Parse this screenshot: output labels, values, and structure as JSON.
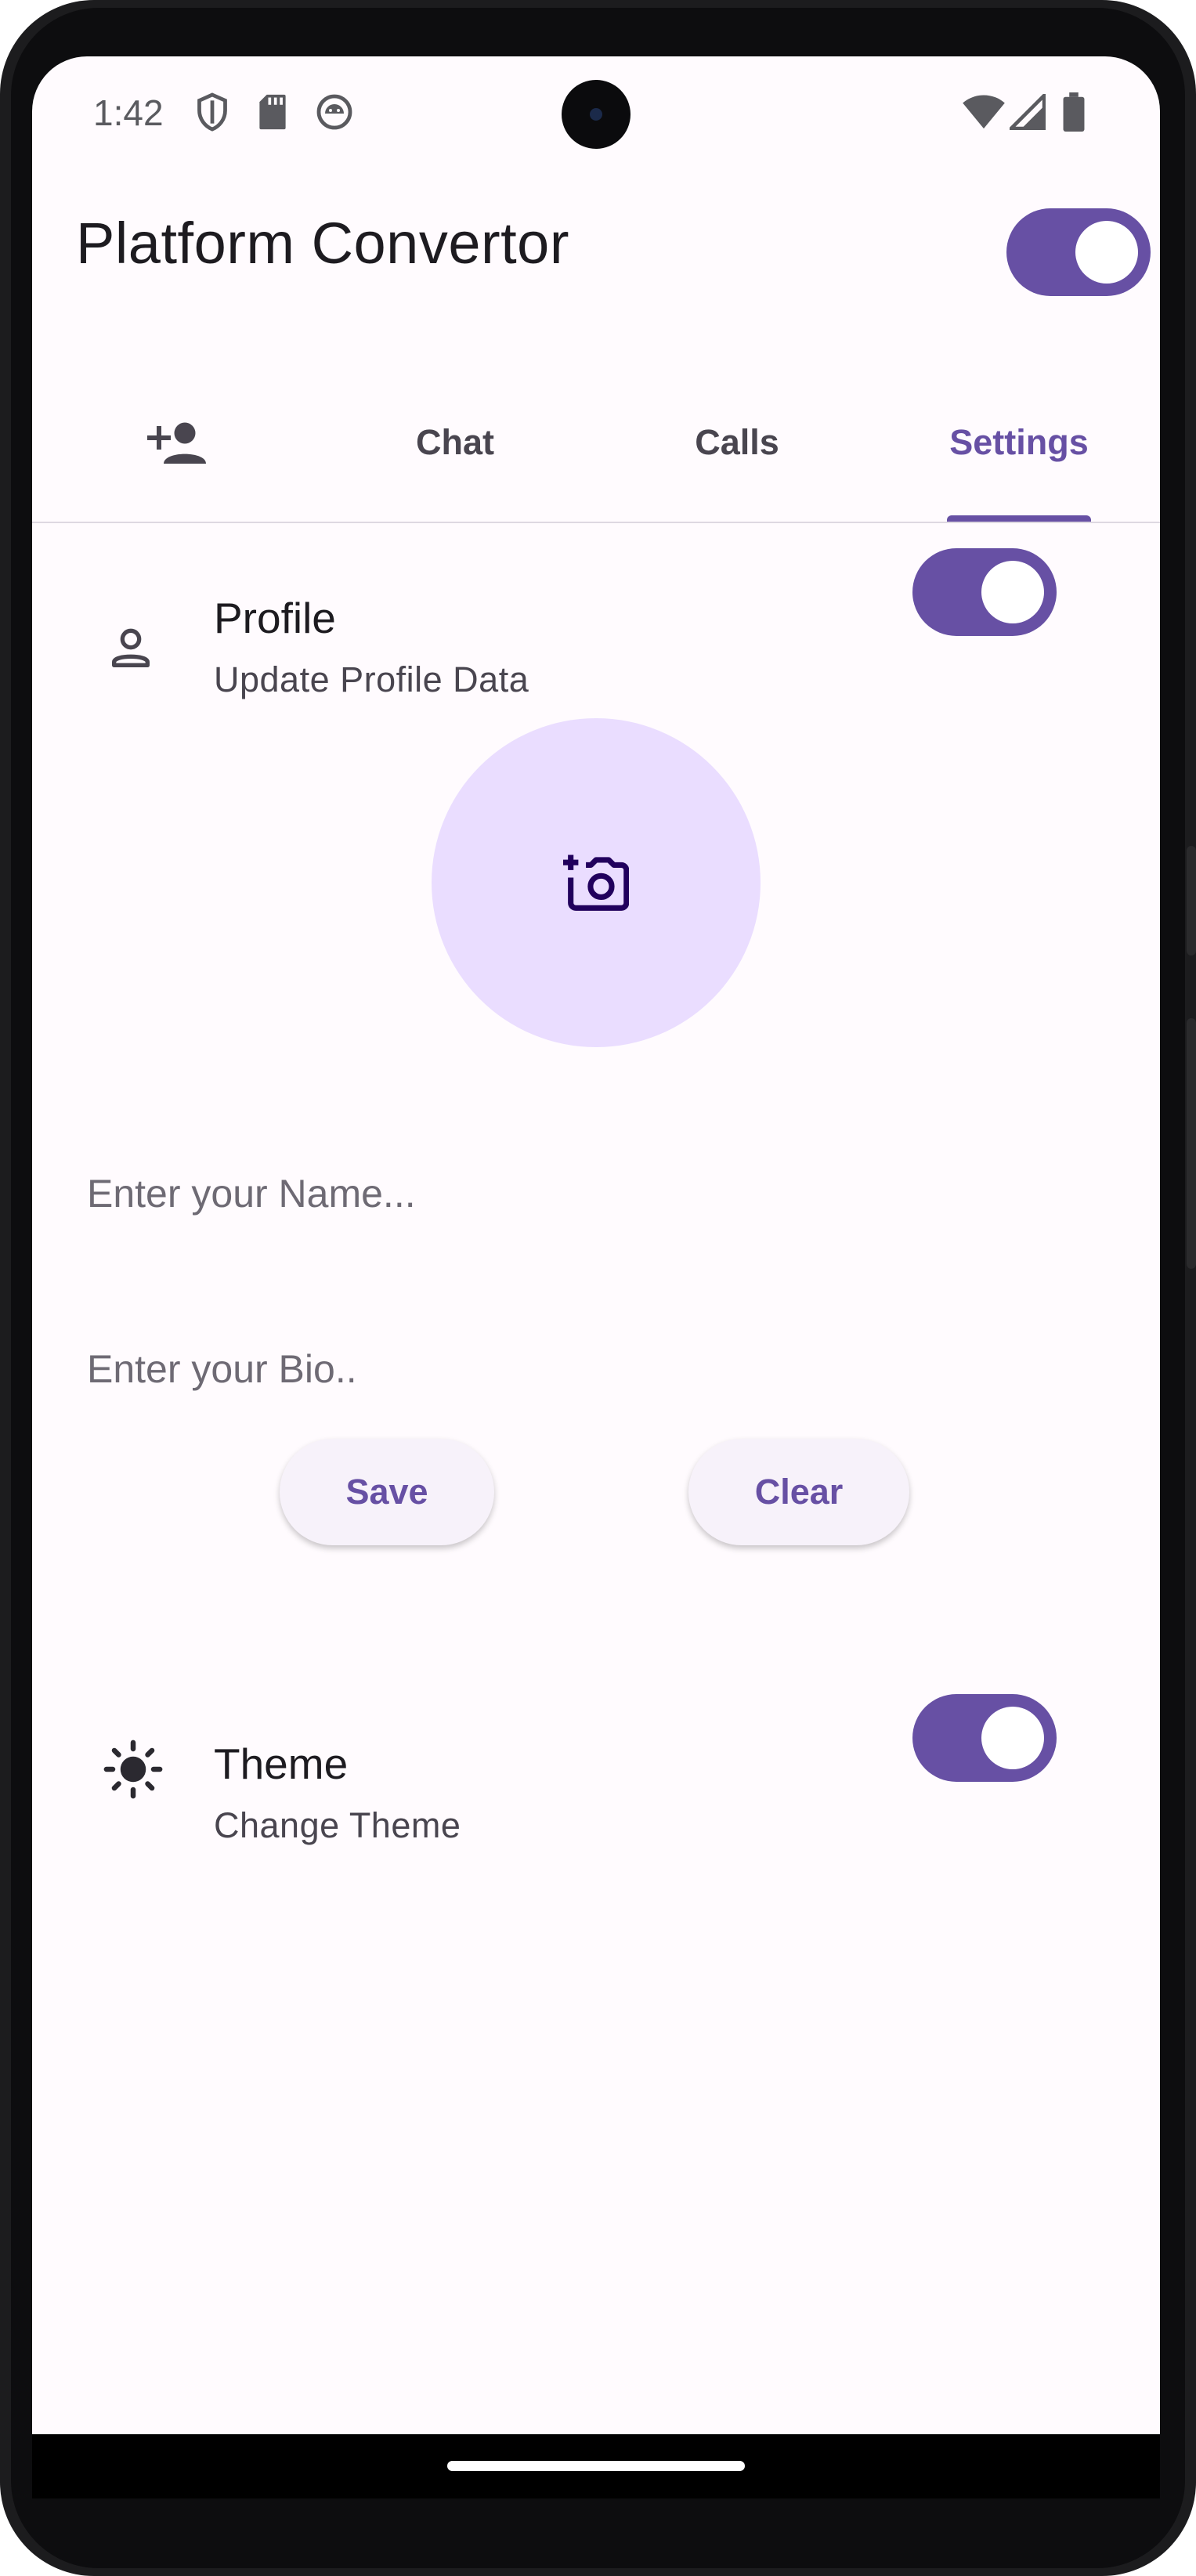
{
  "status_bar": {
    "time": "1:42",
    "left_icons": [
      "shield-icon",
      "sd-card-icon",
      "android-debug-icon"
    ],
    "right_icons": [
      "wifi-icon",
      "cell-signal-icon",
      "battery-icon"
    ]
  },
  "app_bar": {
    "title": "Platform Convertor",
    "platform_switch_on": true
  },
  "tabs": [
    {
      "label": "",
      "icon": "person-add-icon",
      "active": false
    },
    {
      "label": "Chat",
      "active": false
    },
    {
      "label": "Calls",
      "active": false
    },
    {
      "label": "Settings",
      "active": true
    }
  ],
  "profile": {
    "title": "Profile",
    "subtitle": "Update Profile Data",
    "icon": "person-outline-icon",
    "switch_on": true
  },
  "avatar": {
    "icon": "add-a-photo-icon"
  },
  "form": {
    "name_placeholder": "Enter your Name...",
    "name_value": "",
    "bio_placeholder": "Enter your Bio..",
    "bio_value": "",
    "save_label": "Save",
    "clear_label": "Clear"
  },
  "theme": {
    "title": "Theme",
    "subtitle": "Change Theme",
    "icon": "sun-icon",
    "switch_on": true
  },
  "colors": {
    "primary": "#6750a4",
    "background": "#fffbfe",
    "avatar_bg": "#eaddff",
    "button_bg": "#f7f2fa"
  }
}
